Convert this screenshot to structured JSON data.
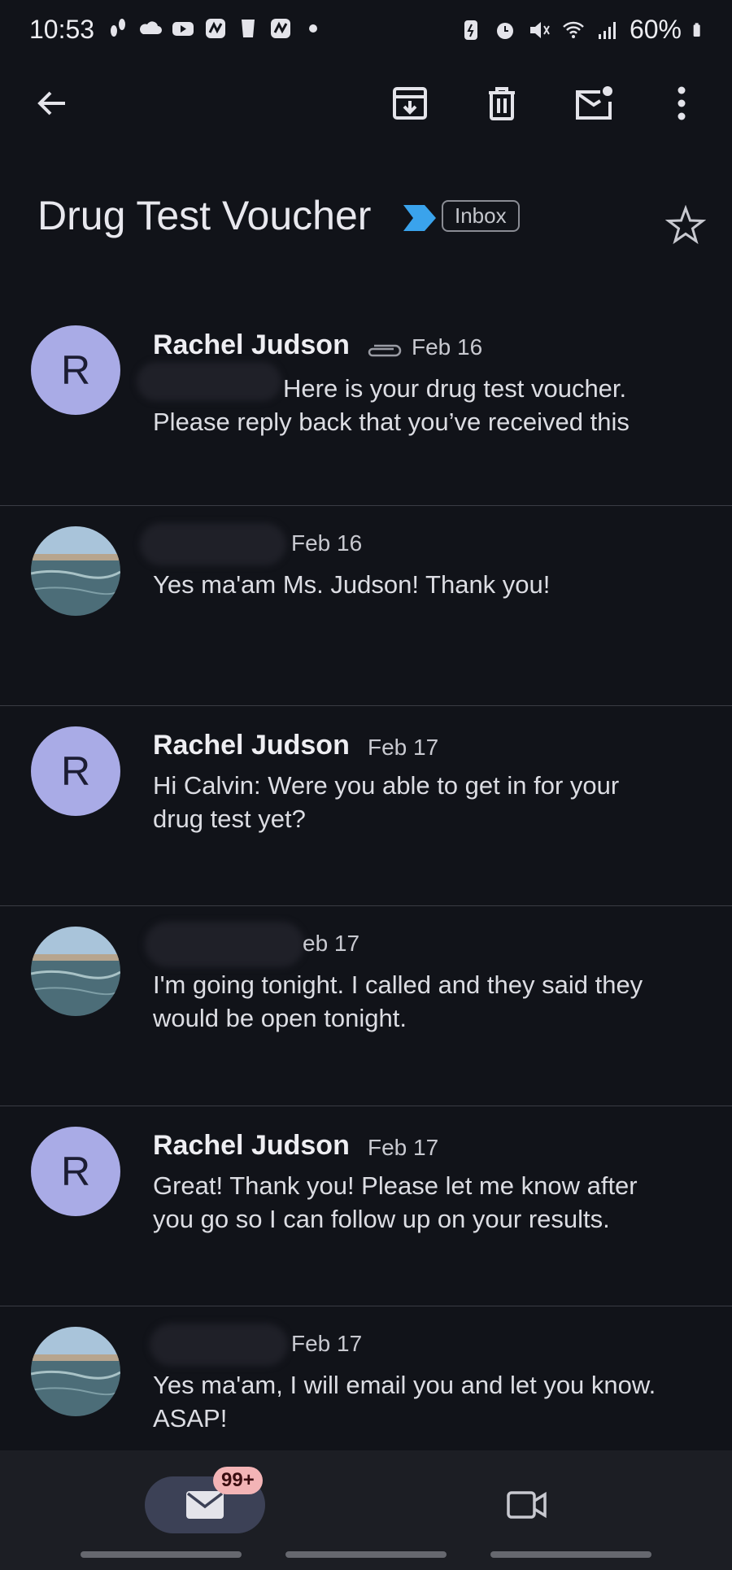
{
  "status_bar": {
    "time": "10:53",
    "battery": "60%"
  },
  "toolbar": {
    "back": "back-arrow-icon",
    "archive": "archive-icon",
    "delete": "trash-icon",
    "mark_unread": "mark-unread-icon",
    "more": "more-vert-icon"
  },
  "thread": {
    "subject": "Drug Test Voucher",
    "label": "Inbox",
    "importance_color": "#3aa3ec"
  },
  "messages": [
    {
      "sender": "Rachel Judson",
      "avatar_letter": "R",
      "date": "Feb 16",
      "has_attachment": true,
      "snippet_line1": "Here is your drug test voucher.",
      "snippet_line2": "Please reply back that you’ve received this"
    },
    {
      "sender": "",
      "avatar_letter": "",
      "date": "Feb 16",
      "snippet_line1": "Yes ma'am Ms. Judson! Thank you!",
      "snippet_line2": ""
    },
    {
      "sender": "Rachel Judson",
      "avatar_letter": "R",
      "date": "Feb 17",
      "snippet_line1": "Hi Calvin: Were you able to get in for your",
      "snippet_line2": "drug test yet?"
    },
    {
      "sender": "",
      "avatar_letter": "",
      "date": "eb 17",
      "snippet_line1": "I'm going tonight. I called and they said they",
      "snippet_line2": "would be open tonight."
    },
    {
      "sender": "Rachel Judson",
      "avatar_letter": "R",
      "date": "Feb 17",
      "snippet_line1": "Great! Thank you! Please let me know after",
      "snippet_line2": "you go so I can follow up on your results."
    },
    {
      "sender": "",
      "avatar_letter": "",
      "date": "Feb 17",
      "snippet_line1": "Yes ma'am, I will email you and let you know.",
      "snippet_line2": "ASAP!"
    }
  ],
  "bottom_nav": {
    "mail_badge": "99+",
    "mail_icon": "mail-icon",
    "meet_icon": "video-camera-icon"
  }
}
